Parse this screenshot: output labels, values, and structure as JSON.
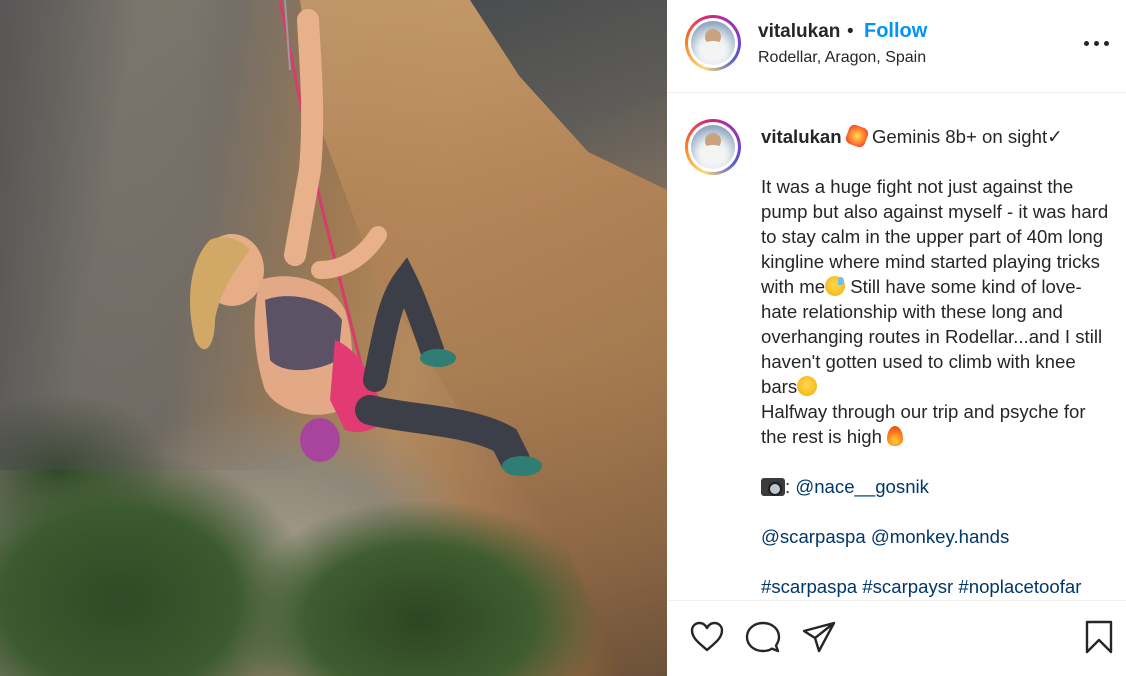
{
  "post": {
    "username": "vitalukan",
    "follow_label": "Follow",
    "separator": "•",
    "location": "Rodellar, Aragon, Spain",
    "caption": {
      "title": "Geminis 8b+ on sight✓",
      "line_1": "It was a huge fight not just against the pump but also against myself - it was hard to stay calm in the upper part of 40m long kingline where mind started playing tricks with me",
      "line_2": " Still have some kind of love-hate relationship with these long and overhanging routes in Rodellar...and I still haven't gotten used to climb with knee bars",
      "line_3": "Halfway through our trip and psyche for the rest is high ",
      "photo_credit_prefix": ": ",
      "photo_credit": "@nace__gosnik",
      "mention_1": "@scarpaspa",
      "mention_2": "@monkey.hands",
      "hashtags": "#scarpaspa #scarpaysr #noplacetoofar"
    }
  },
  "icons": {
    "more": "more-options-icon",
    "like": "heart-icon",
    "comment": "comment-icon",
    "share": "share-icon",
    "save": "bookmark-icon"
  },
  "colors": {
    "follow": "#0095f6",
    "mention": "#00376b",
    "text": "#262626"
  }
}
